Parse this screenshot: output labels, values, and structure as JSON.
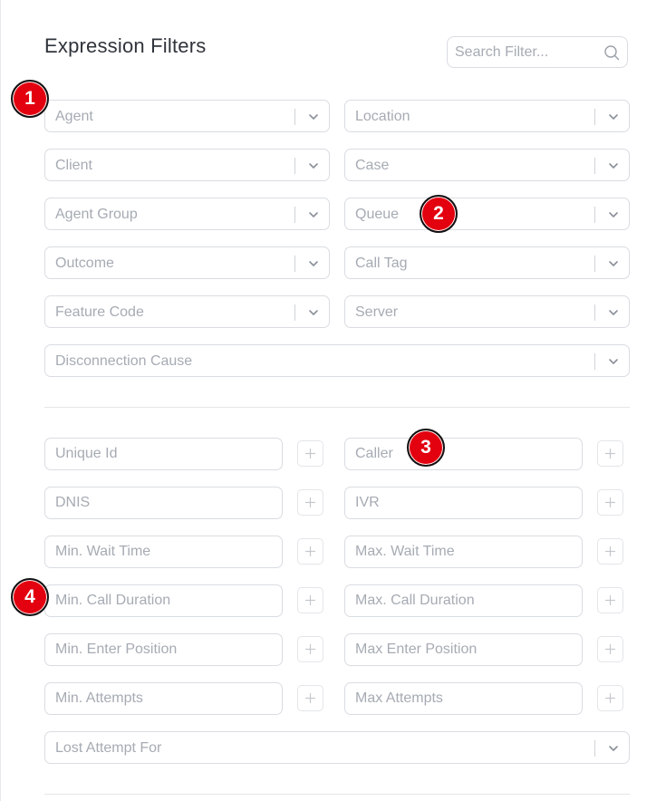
{
  "header": {
    "title": "Expression Filters"
  },
  "search": {
    "placeholder": "Search Filter..."
  },
  "selects": [
    {
      "label": "Agent"
    },
    {
      "label": "Location"
    },
    {
      "label": "Client"
    },
    {
      "label": "Case"
    },
    {
      "label": "Agent Group"
    },
    {
      "label": "Queue"
    },
    {
      "label": "Outcome"
    },
    {
      "label": "Call Tag"
    },
    {
      "label": "Feature Code"
    },
    {
      "label": "Server"
    },
    {
      "label": "Disconnection Cause"
    }
  ],
  "inputs": [
    {
      "placeholder": "Unique Id"
    },
    {
      "placeholder": "Caller"
    },
    {
      "placeholder": "DNIS"
    },
    {
      "placeholder": "IVR"
    },
    {
      "placeholder": "Min. Wait Time"
    },
    {
      "placeholder": "Max. Wait Time"
    },
    {
      "placeholder": "Min. Call Duration"
    },
    {
      "placeholder": "Max. Call Duration"
    },
    {
      "placeholder": "Min. Enter Position"
    },
    {
      "placeholder": "Max Enter Position"
    },
    {
      "placeholder": "Min. Attempts"
    },
    {
      "placeholder": "Max Attempts"
    }
  ],
  "lost_attempt": {
    "label": "Lost Attempt For"
  },
  "markers": [
    "1",
    "2",
    "3",
    "4"
  ],
  "colors": {
    "marker_fill": "#e3000f",
    "border": "#d9dce1",
    "placeholder": "#a6abb3"
  },
  "icons": {
    "search": "search-icon",
    "dropdown": "chevron-down-icon",
    "add": "plus-icon"
  }
}
